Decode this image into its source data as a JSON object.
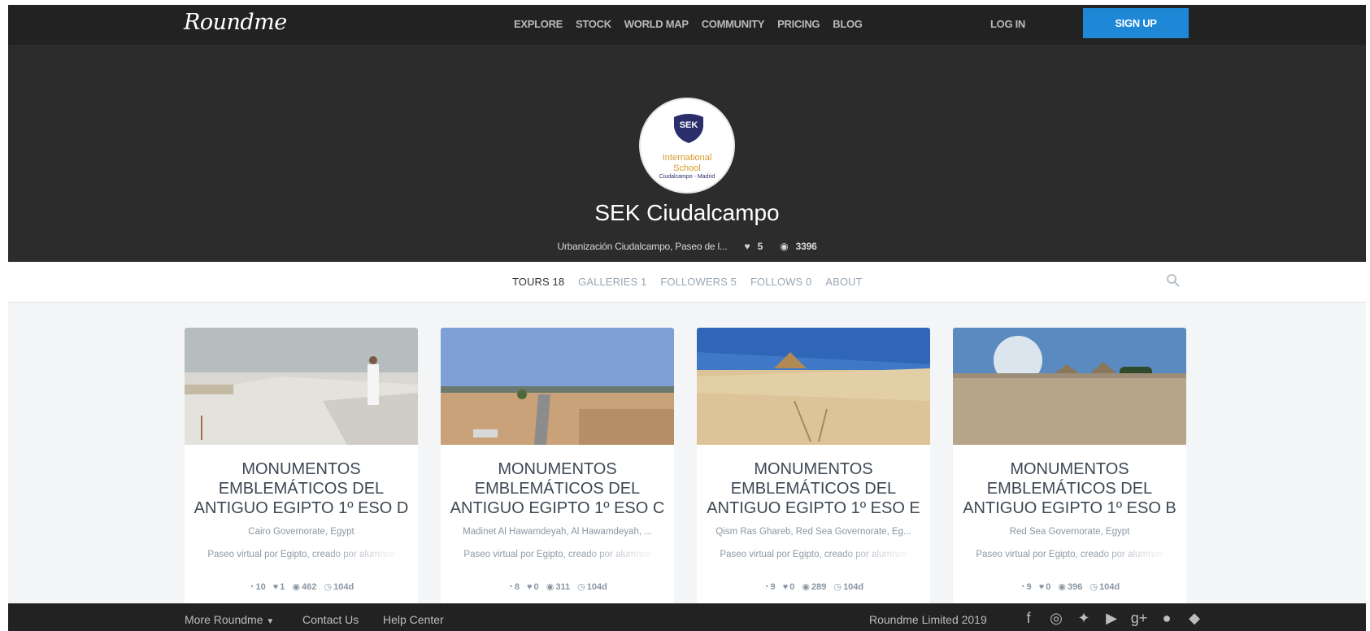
{
  "header": {
    "logo": "Roundme",
    "nav": [
      "EXPLORE",
      "STOCK",
      "WORLD MAP",
      "COMMUNITY",
      "PRICING",
      "BLOG"
    ],
    "login": "LOG IN",
    "signup": "SIGN UP"
  },
  "profile": {
    "logo_text": {
      "abbr": "SEK",
      "line1": "International",
      "line2": "School",
      "line3": "Ciudalcampo - Madrid"
    },
    "name": "SEK Ciudalcampo",
    "address": "Urbanización Ciudalcampo, Paseo de l...",
    "likes": "5",
    "views": "3396"
  },
  "tabs": [
    {
      "label": "TOURS",
      "count": "18",
      "active": true
    },
    {
      "label": "GALLERIES",
      "count": "1",
      "active": false
    },
    {
      "label": "FOLLOWERS",
      "count": "5",
      "active": false
    },
    {
      "label": "FOLLOWS",
      "count": "0",
      "active": false
    },
    {
      "label": "ABOUT",
      "count": "",
      "active": false
    }
  ],
  "cards": [
    {
      "title": "MONUMENTOS EMBLEMÁTICOS DEL ANTIGUO EGIPTO 1º ESO D",
      "location": "Cairo Governorate, Egypt",
      "description": "Paseo virtual por Egipto, creado por alumnos",
      "panoramas": "10",
      "likes": "1",
      "views": "462",
      "age": "104d"
    },
    {
      "title": "MONUMENTOS EMBLEMÁTICOS DEL ANTIGUO EGIPTO 1º ESO C",
      "location": "Madinet Al Hawamdeyah, Al Hawamdeyah, ...",
      "description": "Paseo virtual por Egipto, creado por alumnos",
      "panoramas": "8",
      "likes": "0",
      "views": "311",
      "age": "104d"
    },
    {
      "title": "MONUMENTOS EMBLEMÁTICOS DEL ANTIGUO EGIPTO 1º ESO E",
      "location": "Qism Ras Ghareb, Red Sea Governorate, Eg...",
      "description": "Paseo virtual por Egipto, creado por alumnos",
      "panoramas": "9",
      "likes": "0",
      "views": "289",
      "age": "104d"
    },
    {
      "title": "MONUMENTOS EMBLEMÁTICOS DEL ANTIGUO EGIPTO 1º ESO B",
      "location": "Red Sea Governorate, Egypt",
      "description": "Paseo virtual por Egipto, creado por alumnos",
      "panoramas": "9",
      "likes": "0",
      "views": "396",
      "age": "104d"
    }
  ],
  "footer": {
    "more": "More Roundme",
    "contact": "Contact Us",
    "help": "Help Center",
    "copyright": "Roundme Limited 2019",
    "social_icons": [
      "facebook-icon",
      "instagram-icon",
      "twitter-icon",
      "youtube-icon",
      "google-plus-icon",
      "apple-icon",
      "android-icon"
    ]
  },
  "colors": {
    "topbar": "#222223",
    "hero": "#2c2c2d",
    "accent": "#1e88d6",
    "page_bg": "#f4f5f7"
  }
}
